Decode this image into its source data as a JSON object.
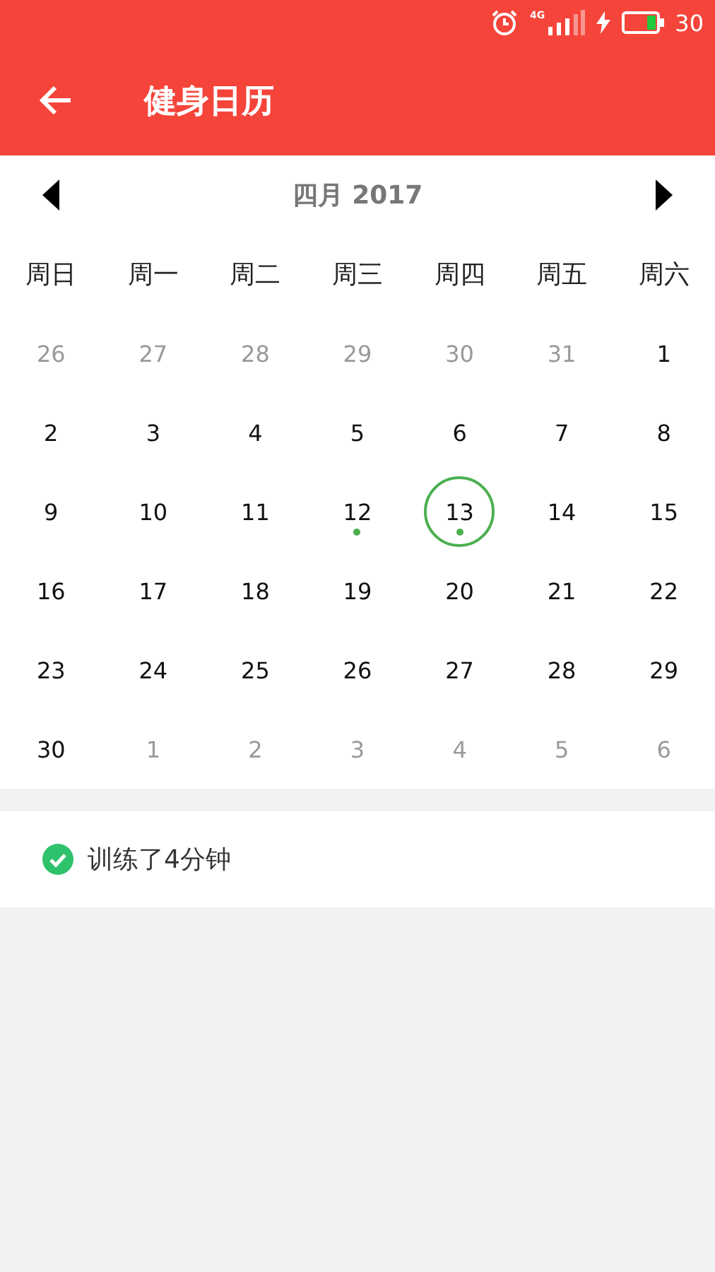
{
  "status_bar": {
    "network": "4G",
    "battery": "30"
  },
  "app_bar": {
    "title": "健身日历"
  },
  "calendar": {
    "month_title": "四月 2017",
    "weekdays": [
      "周日",
      "周一",
      "周二",
      "周三",
      "周四",
      "周五",
      "周六"
    ],
    "days": [
      {
        "label": "26",
        "in_month": false,
        "selected": false,
        "has_record": false
      },
      {
        "label": "27",
        "in_month": false,
        "selected": false,
        "has_record": false
      },
      {
        "label": "28",
        "in_month": false,
        "selected": false,
        "has_record": false
      },
      {
        "label": "29",
        "in_month": false,
        "selected": false,
        "has_record": false
      },
      {
        "label": "30",
        "in_month": false,
        "selected": false,
        "has_record": false
      },
      {
        "label": "31",
        "in_month": false,
        "selected": false,
        "has_record": false
      },
      {
        "label": "1",
        "in_month": true,
        "selected": false,
        "has_record": false
      },
      {
        "label": "2",
        "in_month": true,
        "selected": false,
        "has_record": false
      },
      {
        "label": "3",
        "in_month": true,
        "selected": false,
        "has_record": false
      },
      {
        "label": "4",
        "in_month": true,
        "selected": false,
        "has_record": false
      },
      {
        "label": "5",
        "in_month": true,
        "selected": false,
        "has_record": false
      },
      {
        "label": "6",
        "in_month": true,
        "selected": false,
        "has_record": false
      },
      {
        "label": "7",
        "in_month": true,
        "selected": false,
        "has_record": false
      },
      {
        "label": "8",
        "in_month": true,
        "selected": false,
        "has_record": false
      },
      {
        "label": "9",
        "in_month": true,
        "selected": false,
        "has_record": false
      },
      {
        "label": "10",
        "in_month": true,
        "selected": false,
        "has_record": false
      },
      {
        "label": "11",
        "in_month": true,
        "selected": false,
        "has_record": false
      },
      {
        "label": "12",
        "in_month": true,
        "selected": false,
        "has_record": true
      },
      {
        "label": "13",
        "in_month": true,
        "selected": true,
        "has_record": true
      },
      {
        "label": "14",
        "in_month": true,
        "selected": false,
        "has_record": false
      },
      {
        "label": "15",
        "in_month": true,
        "selected": false,
        "has_record": false
      },
      {
        "label": "16",
        "in_month": true,
        "selected": false,
        "has_record": false
      },
      {
        "label": "17",
        "in_month": true,
        "selected": false,
        "has_record": false
      },
      {
        "label": "18",
        "in_month": true,
        "selected": false,
        "has_record": false
      },
      {
        "label": "19",
        "in_month": true,
        "selected": false,
        "has_record": false
      },
      {
        "label": "20",
        "in_month": true,
        "selected": false,
        "has_record": false
      },
      {
        "label": "21",
        "in_month": true,
        "selected": false,
        "has_record": false
      },
      {
        "label": "22",
        "in_month": true,
        "selected": false,
        "has_record": false
      },
      {
        "label": "23",
        "in_month": true,
        "selected": false,
        "has_record": false
      },
      {
        "label": "24",
        "in_month": true,
        "selected": false,
        "has_record": false
      },
      {
        "label": "25",
        "in_month": true,
        "selected": false,
        "has_record": false
      },
      {
        "label": "26",
        "in_month": true,
        "selected": false,
        "has_record": false
      },
      {
        "label": "27",
        "in_month": true,
        "selected": false,
        "has_record": false
      },
      {
        "label": "28",
        "in_month": true,
        "selected": false,
        "has_record": false
      },
      {
        "label": "29",
        "in_month": true,
        "selected": false,
        "has_record": false
      },
      {
        "label": "30",
        "in_month": true,
        "selected": false,
        "has_record": false
      },
      {
        "label": "1",
        "in_month": false,
        "selected": false,
        "has_record": false
      },
      {
        "label": "2",
        "in_month": false,
        "selected": false,
        "has_record": false
      },
      {
        "label": "3",
        "in_month": false,
        "selected": false,
        "has_record": false
      },
      {
        "label": "4",
        "in_month": false,
        "selected": false,
        "has_record": false
      },
      {
        "label": "5",
        "in_month": false,
        "selected": false,
        "has_record": false
      },
      {
        "label": "6",
        "in_month": false,
        "selected": false,
        "has_record": false
      }
    ]
  },
  "records": [
    {
      "text": "训练了4分钟",
      "done": true
    }
  ]
}
